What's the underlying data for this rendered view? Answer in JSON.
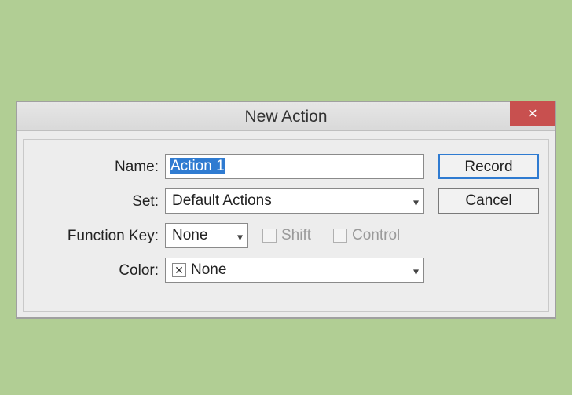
{
  "dialog": {
    "title": "New Action",
    "close_icon": "✕"
  },
  "labels": {
    "name": "Name:",
    "set": "Set:",
    "function_key": "Function Key:",
    "color": "Color:"
  },
  "fields": {
    "name_value": "Action 1",
    "set_value": "Default Actions",
    "function_key_value": "None",
    "shift_label": "Shift",
    "control_label": "Control",
    "color_value": "None",
    "color_x": "✕"
  },
  "buttons": {
    "record": "Record",
    "cancel": "Cancel"
  }
}
